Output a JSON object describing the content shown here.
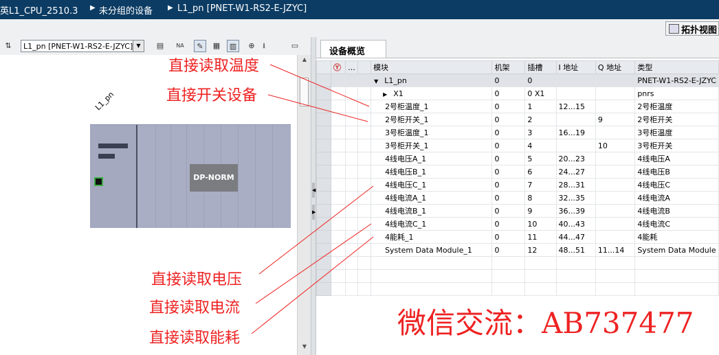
{
  "breadcrumb": [
    "英L1_CPU_2510.3",
    "未分组的设备",
    "L1_pn [PNET-W1-RS2-E-JZYC]"
  ],
  "topology_button": {
    "label": "拓扑视图"
  },
  "left_toolbar": {
    "device_select": "L1_pn [PNET-W1-RS2-E-JZYC]"
  },
  "canvas": {
    "rack_label": "L1_pn",
    "module_label": "DP-NORM"
  },
  "overview_tab": {
    "label": "设备概览"
  },
  "columns": {
    "dots": "...",
    "module": "模块",
    "rack": "机架",
    "slot": "插槽",
    "i_addr": "I 地址",
    "q_addr": "Q 地址",
    "type": "类型"
  },
  "rows": [
    {
      "module": "L1_pn",
      "rack": "0",
      "slot": "0",
      "i_addr": "",
      "q_addr": "",
      "type": "PNET-W1-RS2-E-JZYC",
      "indent": 1,
      "toggle": "▼"
    },
    {
      "module": "X1",
      "rack": "0",
      "slot": "0 X1",
      "i_addr": "",
      "q_addr": "",
      "type": "pnrs",
      "indent": 2,
      "toggle": "▶"
    },
    {
      "module": "2号柜温度_1",
      "rack": "0",
      "slot": "1",
      "i_addr": "12...15",
      "q_addr": "",
      "type": "2号柜温度",
      "indent": 3,
      "toggle": ""
    },
    {
      "module": "2号柜开关_1",
      "rack": "0",
      "slot": "2",
      "i_addr": "",
      "q_addr": "9",
      "type": "2号柜开关",
      "indent": 3,
      "toggle": ""
    },
    {
      "module": "3号柜温度_1",
      "rack": "0",
      "slot": "3",
      "i_addr": "16...19",
      "q_addr": "",
      "type": "3号柜温度",
      "indent": 3,
      "toggle": ""
    },
    {
      "module": "3号柜开关_1",
      "rack": "0",
      "slot": "4",
      "i_addr": "",
      "q_addr": "10",
      "type": "3号柜开关",
      "indent": 3,
      "toggle": ""
    },
    {
      "module": "4线电压A_1",
      "rack": "0",
      "slot": "5",
      "i_addr": "20...23",
      "q_addr": "",
      "type": "4线电压A",
      "indent": 3,
      "toggle": ""
    },
    {
      "module": "4线电压B_1",
      "rack": "0",
      "slot": "6",
      "i_addr": "24...27",
      "q_addr": "",
      "type": "4线电压B",
      "indent": 3,
      "toggle": ""
    },
    {
      "module": "4线电压C_1",
      "rack": "0",
      "slot": "7",
      "i_addr": "28...31",
      "q_addr": "",
      "type": "4线电压C",
      "indent": 3,
      "toggle": ""
    },
    {
      "module": "4线电流A_1",
      "rack": "0",
      "slot": "8",
      "i_addr": "32...35",
      "q_addr": "",
      "type": "4线电流A",
      "indent": 3,
      "toggle": ""
    },
    {
      "module": "4线电流B_1",
      "rack": "0",
      "slot": "9",
      "i_addr": "36...39",
      "q_addr": "",
      "type": "4线电流B",
      "indent": 3,
      "toggle": ""
    },
    {
      "module": "4线电流C_1",
      "rack": "0",
      "slot": "10",
      "i_addr": "40...43",
      "q_addr": "",
      "type": "4线电流C",
      "indent": 3,
      "toggle": ""
    },
    {
      "module": "4能耗_1",
      "rack": "0",
      "slot": "11",
      "i_addr": "44...47",
      "q_addr": "",
      "type": "4能耗",
      "indent": 3,
      "toggle": ""
    },
    {
      "module": "System Data Module_1",
      "rack": "0",
      "slot": "12",
      "i_addr": "48...51",
      "q_addr": "11...14",
      "type": "System Data Module",
      "indent": 3,
      "toggle": ""
    }
  ],
  "empty_rows": 3,
  "annotations": [
    "直接读取温度",
    "直接开关设备",
    "直接读取电压",
    "直接读取电流",
    "直接读取能耗"
  ],
  "watermark": "微信交流：AB737477",
  "colors": {
    "title_bg": "#0c3c64",
    "annotation": "#ee2222",
    "selected_row": "#dfe2e6"
  }
}
